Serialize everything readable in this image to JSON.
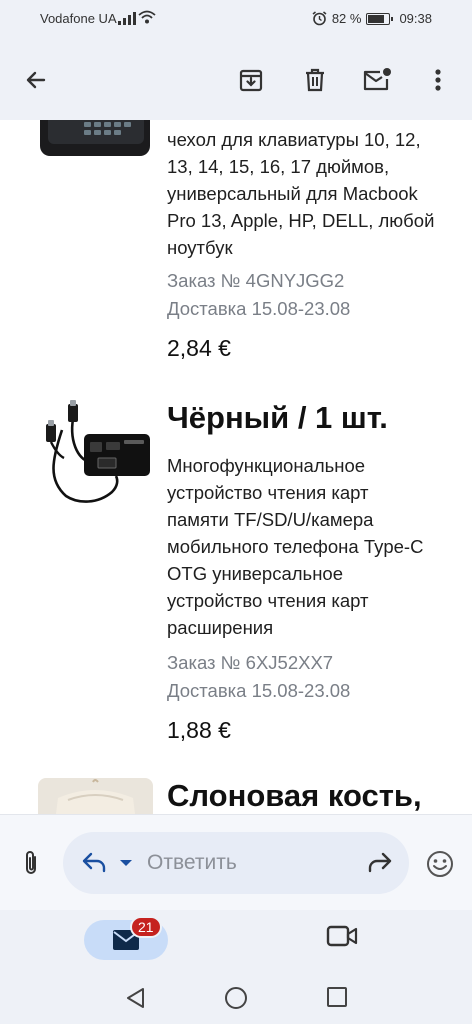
{
  "status_bar": {
    "carrier": "Vodafone UA",
    "battery_text": "82 %",
    "battery_level": 0.82,
    "time": "09:38"
  },
  "toolbar": {
    "back_icon": "arrow-left-icon",
    "archive_icon": "archive-icon",
    "delete_icon": "trash-icon",
    "unread_icon": "mark-unread-icon",
    "more_icon": "more-vert-icon"
  },
  "items": [
    {
      "variant": "",
      "description": "чехол для клавиатуры 10, 12, 13, 14, 15, 16, 17 дюймов, универсальный для Macbook Pro 13, Apple, HP, DELL, любой ноутбук",
      "order": "Заказ № 4GNYJGG2",
      "delivery": "Доставка 15.08-23.08",
      "price": "2,84 €"
    },
    {
      "variant": "Чёрный / 1 шт.",
      "description": "Многофункциональное устройство чтения карт памяти TF/SD/U/камера мобильного телефона Type-C OTG универсальное устройство чтения карт расширения",
      "order": "Заказ № 6XJ52XX7",
      "delivery": "Доставка 15.08-23.08",
      "price": "1,88 €"
    },
    {
      "variant": "Слоновая кость,"
    }
  ],
  "reply": {
    "placeholder": "Ответить"
  },
  "bottom_nav": {
    "mail_badge": "21"
  },
  "colors": {
    "accent": "#1a4fa0",
    "badge": "#c5221f",
    "chrome_bg": "#eef1f7"
  }
}
